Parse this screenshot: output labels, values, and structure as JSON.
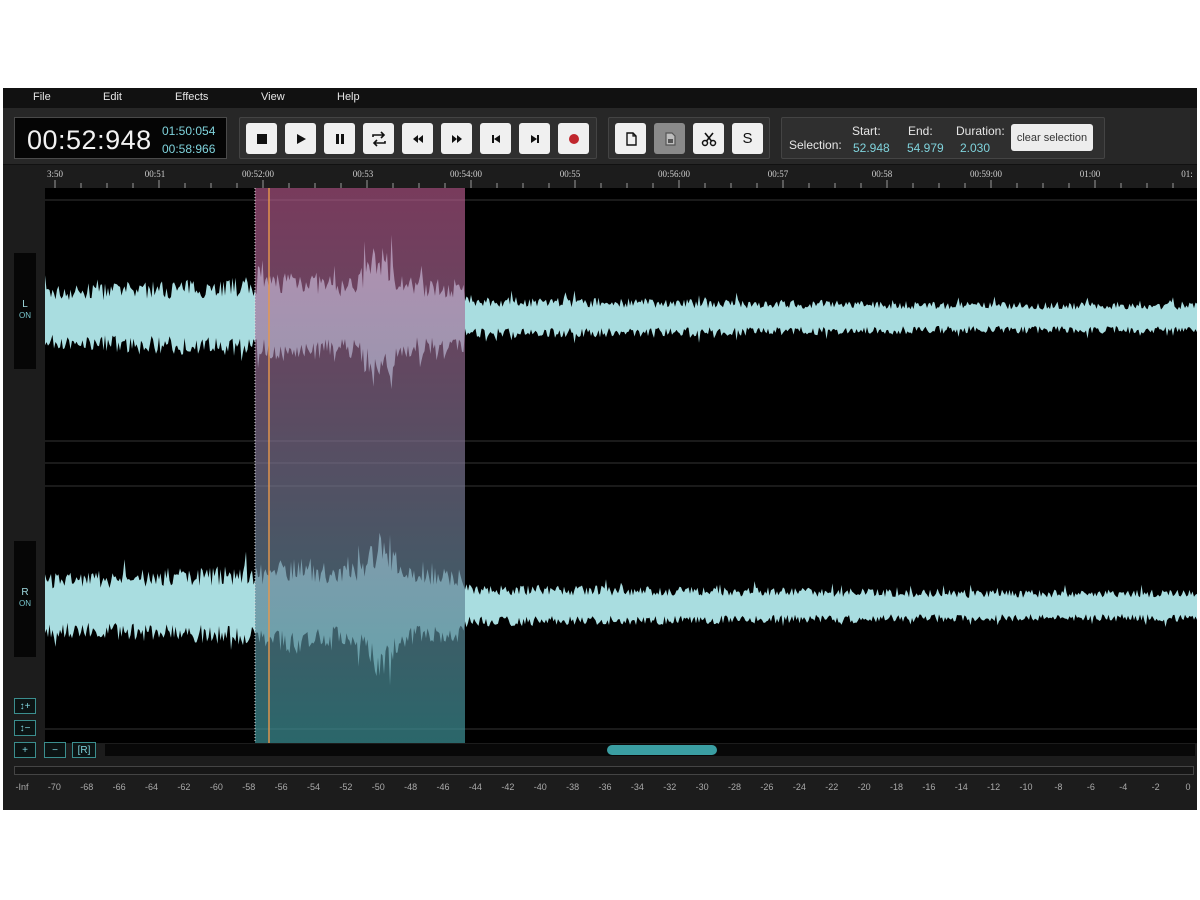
{
  "menu": [
    "File",
    "Edit",
    "Effects",
    "View",
    "Help"
  ],
  "time": {
    "current": "00:52:948",
    "secondary_1": "01:50:054",
    "secondary_2": "00:58:966"
  },
  "transport": [
    {
      "name": "stop-button",
      "icon": "stop-icon"
    },
    {
      "name": "play-button",
      "icon": "play-icon"
    },
    {
      "name": "pause-button",
      "icon": "pause-icon"
    },
    {
      "name": "loop-button",
      "icon": "loop-icon"
    },
    {
      "name": "rewind-button",
      "icon": "rewind-icon"
    },
    {
      "name": "fast-forward-button",
      "icon": "fast-forward-icon"
    },
    {
      "name": "skip-start-button",
      "icon": "skip-start-icon"
    },
    {
      "name": "skip-end-button",
      "icon": "skip-end-icon"
    },
    {
      "name": "record-button",
      "icon": "record-icon"
    }
  ],
  "edit_tools": [
    {
      "name": "copy-button",
      "icon": "copy-icon"
    },
    {
      "name": "paste-button",
      "icon": "paste-icon",
      "disabled": true
    },
    {
      "name": "cut-button",
      "icon": "scissors-icon"
    },
    {
      "name": "s-button",
      "label": "S"
    }
  ],
  "selection": {
    "label": "Selection:",
    "start_label": "Start:",
    "start": "52.948",
    "end_label": "End:",
    "end": "54.979",
    "duration_label": "Duration:",
    "duration": "2.030",
    "clear_label": "clear selection"
  },
  "ruler": {
    "labels": [
      "3:50",
      "00:51",
      "00:52:00",
      "00:53",
      "00:54:00",
      "00:55",
      "00:56:00",
      "00:57",
      "00:58",
      "00:59:00",
      "01:00",
      "01:"
    ]
  },
  "channels": [
    {
      "letter": "L",
      "state": "ON"
    },
    {
      "letter": "R",
      "state": "ON"
    }
  ],
  "zoom_buttons": {
    "v_zoom_in": "↕+",
    "v_zoom_out": "↕−",
    "h_zoom_in": "+",
    "h_zoom_out": "−",
    "reset": "[R]"
  },
  "vu_scale": [
    "-Inf",
    "-70",
    "-68",
    "-66",
    "-64",
    "-62",
    "-60",
    "-58",
    "-56",
    "-54",
    "-52",
    "-50",
    "-48",
    "-46",
    "-44",
    "-42",
    "-40",
    "-38",
    "-36",
    "-34",
    "-32",
    "-30",
    "-28",
    "-26",
    "-24",
    "-22",
    "-20",
    "-18",
    "-16",
    "-14",
    "-12",
    "-10",
    "-8",
    "-6",
    "-4",
    "-2",
    "0"
  ],
  "colors": {
    "waveform": "#a9dde0",
    "selection_top": "#c25f95",
    "selection_bottom": "#3b8f94",
    "cursor": "#e8984c",
    "accent": "#7fd3dc"
  }
}
